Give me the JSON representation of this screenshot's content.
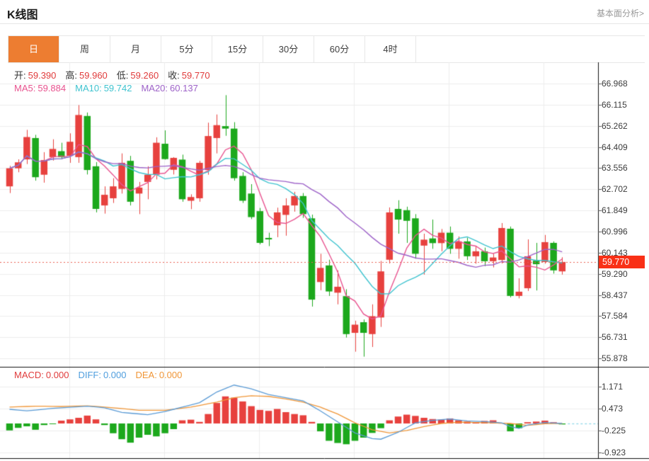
{
  "header": {
    "title": "K线图",
    "link_label": "基本面分析>"
  },
  "tabs": [
    {
      "id": "day",
      "label": "日",
      "selected": true
    },
    {
      "id": "week",
      "label": "周",
      "selected": false
    },
    {
      "id": "month",
      "label": "月",
      "selected": false
    },
    {
      "id": "5min",
      "label": "5分",
      "selected": false
    },
    {
      "id": "15min",
      "label": "15分",
      "selected": false
    },
    {
      "id": "30min",
      "label": "30分",
      "selected": false
    },
    {
      "id": "60min",
      "label": "60分",
      "selected": false
    },
    {
      "id": "4hour",
      "label": "4时",
      "selected": false
    }
  ],
  "info": {
    "ohlc": [
      {
        "label": "开:",
        "value": "59.390"
      },
      {
        "label": "高:",
        "value": "59.960"
      },
      {
        "label": "低:",
        "value": "59.260"
      },
      {
        "label": "收:",
        "value": "59.770"
      }
    ],
    "ma": [
      {
        "label": "MA5:",
        "value": "59.884",
        "color": "#e8538f"
      },
      {
        "label": "MA10:",
        "value": "59.742",
        "color": "#3fc3cf"
      },
      {
        "label": "MA20:",
        "value": "60.137",
        "color": "#9d62c8"
      }
    ],
    "macd": [
      {
        "label": "MACD:",
        "value": "0.000",
        "color": "#e03c3c"
      },
      {
        "label": "DIFF:",
        "value": "0.000",
        "color": "#4f9ede"
      },
      {
        "label": "DEA:",
        "value": "0.000",
        "color": "#f09637"
      }
    ]
  },
  "chart_data": {
    "type": "candlestick+macd",
    "title": "K线图",
    "timeframe_selected": "日",
    "current_price": 59.77,
    "current_price_label": "59.770",
    "y_axis_ticks_main": [
      66.968,
      66.115,
      65.262,
      64.409,
      63.556,
      62.702,
      61.849,
      60.996,
      60.143,
      59.29,
      58.437,
      57.584,
      56.731,
      55.878
    ],
    "y_axis_ticks_macd": [
      1.171,
      0.473,
      -0.225,
      -0.923
    ],
    "ma_periods": [
      5,
      10,
      20
    ],
    "candles": [
      [
        62.82,
        63.65,
        62.55,
        63.55
      ],
      [
        63.55,
        63.91,
        63.39,
        63.79
      ],
      [
        63.91,
        65.1,
        63.72,
        64.81
      ],
      [
        64.77,
        64.9,
        63.05,
        63.19
      ],
      [
        63.29,
        64.2,
        62.97,
        63.88
      ],
      [
        64.0,
        64.72,
        63.86,
        64.33
      ],
      [
        64.24,
        64.58,
        63.91,
        64.0
      ],
      [
        64.05,
        64.96,
        63.77,
        64.62
      ],
      [
        64.0,
        66.1,
        63.77,
        65.7
      ],
      [
        65.66,
        65.8,
        63.3,
        63.48
      ],
      [
        63.63,
        63.8,
        61.77,
        61.91
      ],
      [
        62.05,
        62.82,
        61.72,
        62.48
      ],
      [
        62.34,
        63.15,
        62.15,
        62.82
      ],
      [
        62.72,
        64.15,
        62.53,
        63.77
      ],
      [
        63.85,
        64.05,
        62.05,
        62.2
      ],
      [
        62.53,
        63.0,
        61.7,
        62.77
      ],
      [
        63.0,
        63.63,
        62.3,
        63.29
      ],
      [
        63.29,
        64.8,
        63.1,
        64.58
      ],
      [
        64.54,
        65.08,
        63.9,
        63.92
      ],
      [
        63.49,
        64.0,
        63.3,
        63.97
      ],
      [
        63.9,
        64.1,
        62.2,
        62.3
      ],
      [
        62.24,
        62.5,
        61.9,
        62.39
      ],
      [
        62.34,
        63.85,
        62.2,
        63.77
      ],
      [
        63.48,
        65.39,
        63.29,
        64.85
      ],
      [
        64.77,
        65.72,
        64.15,
        65.29
      ],
      [
        65.25,
        66.5,
        64.86,
        65.15
      ],
      [
        65.15,
        65.41,
        63.05,
        63.15
      ],
      [
        63.24,
        63.39,
        62.15,
        62.24
      ],
      [
        62.53,
        62.91,
        61.5,
        61.58
      ],
      [
        61.82,
        61.95,
        60.48,
        60.54
      ],
      [
        60.74,
        60.95,
        60.41,
        60.68
      ],
      [
        61.25,
        61.96,
        60.77,
        61.77
      ],
      [
        61.67,
        62.34,
        60.83,
        62.05
      ],
      [
        62.05,
        62.6,
        61.8,
        62.43
      ],
      [
        62.43,
        62.55,
        61.55,
        61.7
      ],
      [
        61.53,
        61.68,
        57.97,
        58.25
      ],
      [
        58.96,
        60.1,
        58.63,
        59.53
      ],
      [
        59.63,
        59.86,
        58.4,
        58.58
      ],
      [
        58.53,
        59.43,
        58.06,
        58.77
      ],
      [
        58.39,
        58.67,
        56.72,
        56.86
      ],
      [
        56.91,
        57.4,
        56.15,
        57.24
      ],
      [
        57.34,
        57.45,
        55.95,
        56.91
      ],
      [
        56.86,
        58.06,
        56.34,
        57.58
      ],
      [
        57.53,
        59.81,
        57.15,
        59.39
      ],
      [
        59.86,
        61.97,
        59.71,
        61.77
      ],
      [
        61.91,
        62.26,
        60.91,
        61.48
      ],
      [
        61.86,
        62.0,
        60.54,
        61.43
      ],
      [
        61.53,
        61.7,
        59.9,
        60.1
      ],
      [
        60.43,
        60.91,
        59.26,
        60.67
      ],
      [
        60.72,
        61.48,
        60.3,
        60.53
      ],
      [
        60.53,
        61.1,
        60.2,
        60.95
      ],
      [
        60.95,
        61.2,
        60.1,
        60.3
      ],
      [
        60.3,
        60.8,
        59.9,
        60.6
      ],
      [
        60.6,
        60.75,
        59.85,
        60.0
      ],
      [
        60.0,
        60.4,
        59.7,
        60.2
      ],
      [
        60.2,
        60.35,
        59.6,
        59.8
      ],
      [
        59.8,
        60.1,
        59.55,
        59.95
      ],
      [
        59.85,
        61.34,
        59.71,
        61.14
      ],
      [
        61.11,
        61.2,
        58.34,
        58.4
      ],
      [
        58.4,
        59.11,
        58.3,
        58.57
      ],
      [
        58.71,
        60.68,
        58.6,
        60.0
      ],
      [
        59.82,
        60.54,
        58.62,
        59.68
      ],
      [
        59.77,
        60.86,
        59.7,
        60.57
      ],
      [
        60.54,
        60.6,
        59.3,
        59.43
      ],
      [
        59.39,
        59.96,
        59.26,
        59.77
      ]
    ],
    "macd_histogram": [
      -0.22,
      -0.14,
      -0.09,
      -0.2,
      -0.05,
      -0.02,
      0.09,
      0.13,
      0.18,
      0.25,
      0.13,
      -0.05,
      -0.31,
      -0.5,
      -0.61,
      -0.45,
      -0.36,
      -0.41,
      -0.31,
      -0.18,
      0.1,
      0.12,
      0.05,
      0.3,
      0.65,
      0.86,
      0.82,
      0.7,
      0.55,
      0.43,
      0.4,
      0.46,
      0.36,
      0.3,
      0.26,
      0.05,
      -0.25,
      -0.55,
      -0.62,
      -0.66,
      -0.55,
      -0.45,
      -0.3,
      -0.15,
      0.1,
      0.22,
      0.28,
      0.24,
      0.18,
      0.14,
      0.12,
      0.16,
      0.1,
      0.06,
      0.04,
      0.08,
      0.1,
      0.02,
      -0.25,
      -0.15,
      0.04,
      0.06,
      0.09,
      0.04,
      -0.03
    ],
    "macd_diff_points": [
      [
        0,
        0.45
      ],
      [
        2,
        0.4
      ],
      [
        5,
        0.48
      ],
      [
        9,
        0.55
      ],
      [
        11,
        0.5
      ],
      [
        13,
        0.35
      ],
      [
        16,
        0.28
      ],
      [
        18,
        0.38
      ],
      [
        20,
        0.52
      ],
      [
        22,
        0.66
      ],
      [
        24,
        1.0
      ],
      [
        26,
        1.22
      ],
      [
        28,
        1.1
      ],
      [
        30,
        0.92
      ],
      [
        32,
        0.82
      ],
      [
        34,
        0.72
      ],
      [
        36,
        0.4
      ],
      [
        38,
        0.05
      ],
      [
        40,
        -0.3
      ],
      [
        42,
        -0.48
      ],
      [
        43,
        -0.5
      ],
      [
        45,
        -0.28
      ],
      [
        47,
        0.02
      ],
      [
        49,
        0.1
      ],
      [
        51,
        0.14
      ],
      [
        53,
        0.08
      ],
      [
        55,
        0.06
      ],
      [
        57,
        0.02
      ],
      [
        58,
        -0.1
      ],
      [
        59,
        -0.16
      ],
      [
        60,
        -0.05
      ],
      [
        62,
        0.03
      ],
      [
        64,
        0.0
      ]
    ],
    "macd_dea_points": [
      [
        0,
        0.52
      ],
      [
        3,
        0.55
      ],
      [
        6,
        0.54
      ],
      [
        9,
        0.56
      ],
      [
        12,
        0.5
      ],
      [
        15,
        0.42
      ],
      [
        18,
        0.42
      ],
      [
        21,
        0.52
      ],
      [
        24,
        0.68
      ],
      [
        26,
        0.82
      ],
      [
        28,
        0.88
      ],
      [
        30,
        0.86
      ],
      [
        32,
        0.78
      ],
      [
        34,
        0.68
      ],
      [
        36,
        0.52
      ],
      [
        38,
        0.3
      ],
      [
        40,
        0.02
      ],
      [
        42,
        -0.2
      ],
      [
        44,
        -0.3
      ],
      [
        46,
        -0.22
      ],
      [
        48,
        -0.1
      ],
      [
        50,
        0.0
      ],
      [
        52,
        0.04
      ],
      [
        54,
        0.03
      ],
      [
        56,
        0.02
      ],
      [
        58,
        0.0
      ],
      [
        60,
        -0.06
      ],
      [
        62,
        -0.01
      ],
      [
        64,
        0.0
      ]
    ],
    "colors": {
      "up": "#e7413e",
      "down": "#1ca81c",
      "ma5": "#e8538f",
      "ma10": "#3fc3cf",
      "ma20": "#9d62c8",
      "diff": "#5b9bd5",
      "dea": "#f09637",
      "badge": "#f93016",
      "dotted_line": "#e95f52",
      "grid": "#ececec",
      "axis": "#111111",
      "tab_selected_bg": "#ed7d31"
    }
  }
}
